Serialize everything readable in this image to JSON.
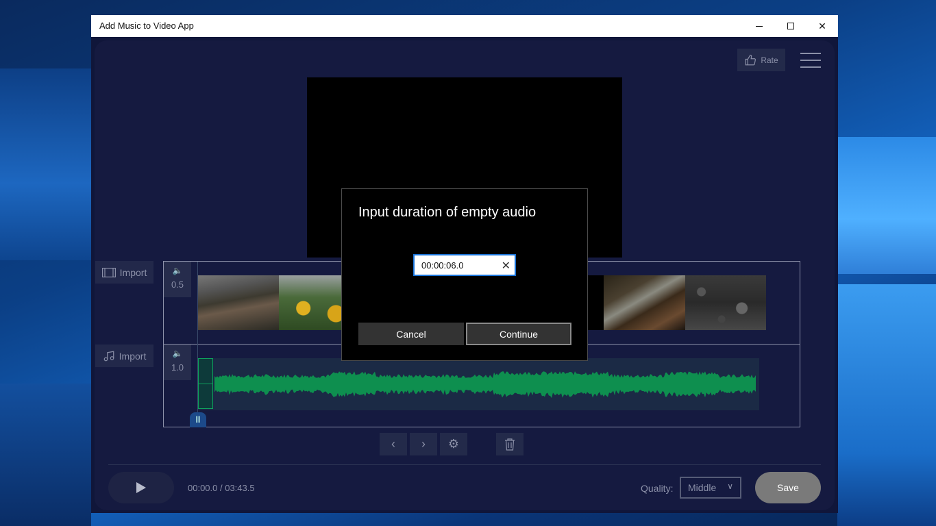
{
  "window": {
    "title": "Add Music to Video App",
    "minimize_label": "",
    "maximize_label": "",
    "close_label": "✕"
  },
  "header": {
    "rate_label": "Rate",
    "rate_icon": "thumbs-up-icon",
    "menu_icon": "hamburger-menu-icon"
  },
  "tracks": {
    "video": {
      "import_label": "Import",
      "volume": "0.5"
    },
    "audio": {
      "import_label": "Import",
      "volume": "1.0"
    }
  },
  "controls": {
    "prev_icon": "‹",
    "next_icon": "›",
    "gear_icon": "⚙",
    "delete_icon": "🗑"
  },
  "footer": {
    "time": "00:00.0 / 03:43.5",
    "quality_label": "Quality:",
    "quality_value": "Middle",
    "save_label": "Save"
  },
  "dialog": {
    "title": "Input duration of empty audio",
    "input_value": "00:00:06.0",
    "cancel_label": "Cancel",
    "continue_label": "Continue"
  },
  "colors": {
    "waveform": "#0e8f4f",
    "accent": "#1a73d8",
    "background": "#151a40"
  }
}
